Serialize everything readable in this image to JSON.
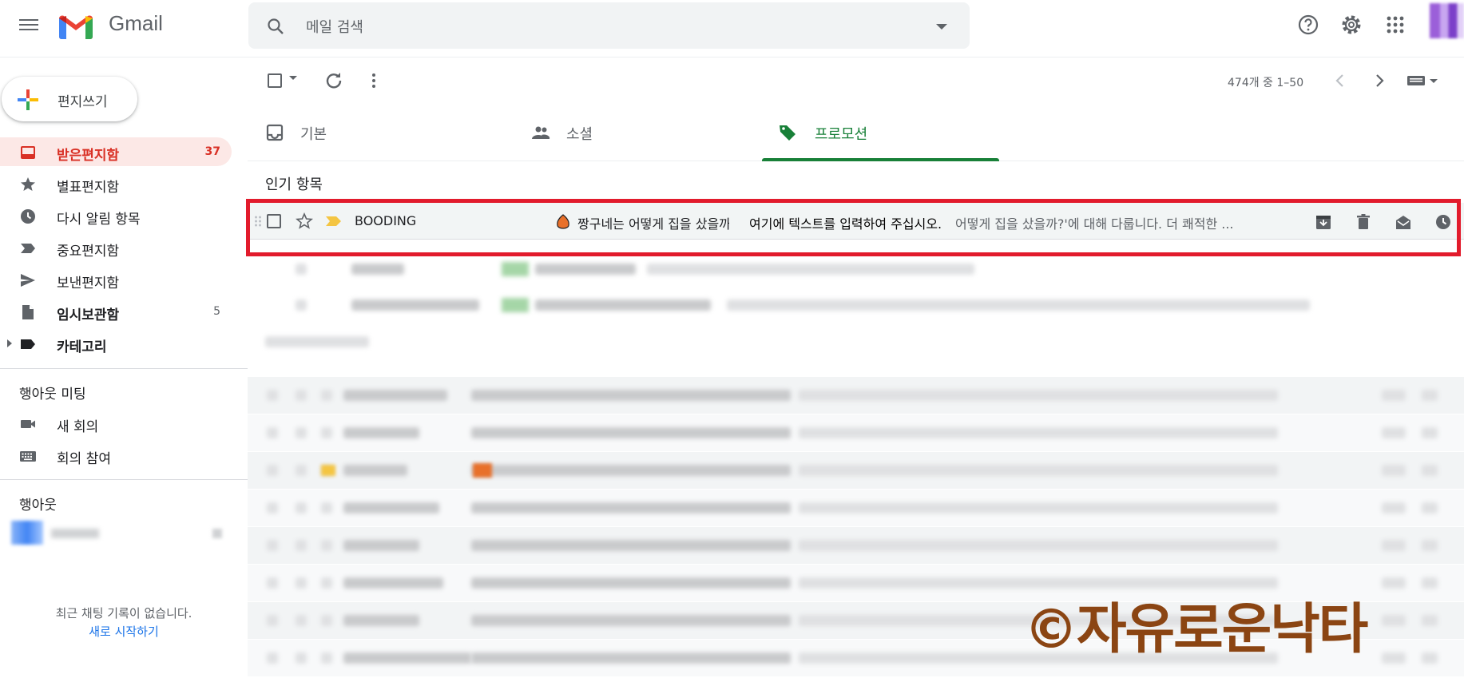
{
  "header": {
    "logo_text": "Gmail",
    "search_placeholder": "메일 검색"
  },
  "sidebar": {
    "compose_label": "편지쓰기",
    "items": [
      {
        "label": "받은편지함",
        "count": "37",
        "icon": "inbox-icon"
      },
      {
        "label": "별표편지함",
        "count": "",
        "icon": "star-icon"
      },
      {
        "label": "다시 알림 항목",
        "count": "",
        "icon": "clock-icon"
      },
      {
        "label": "중요편지함",
        "count": "",
        "icon": "important-icon"
      },
      {
        "label": "보낸편지함",
        "count": "",
        "icon": "send-icon"
      },
      {
        "label": "임시보관함",
        "count": "5",
        "icon": "draft-icon"
      },
      {
        "label": "카테고리",
        "count": "",
        "icon": "label-icon"
      }
    ],
    "meet_title": "행아웃 미팅",
    "meet_items": [
      "새 회의",
      "회의 참여"
    ],
    "hangouts_title": "행아웃",
    "no_chat": "최근 채팅 기록이 없습니다.",
    "start_new": "새로 시작하기"
  },
  "toolbar": {
    "range": "474개 중 1–50"
  },
  "tabs": [
    {
      "label": "기본",
      "icon": "inbox-tab-icon"
    },
    {
      "label": "소셜",
      "icon": "people-icon"
    },
    {
      "label": "프로모션",
      "icon": "tag-icon"
    }
  ],
  "section_title": "인기 항목",
  "featured_mail": {
    "sender": "BOODING",
    "subject": "짱구네는 어떻게 집을 샀을까",
    "overlay": "여기에 텍스트를 입력하여 주십시오.",
    "snippet": "어떻게 집을 샀을까?'에 대해 다룹니다. 더 쾌적한 ..."
  },
  "watermark": "©자유로운낙타",
  "colors": {
    "accent_red": "#d93025",
    "promo_green": "#188038",
    "highlight_box": "#e21b2c"
  }
}
